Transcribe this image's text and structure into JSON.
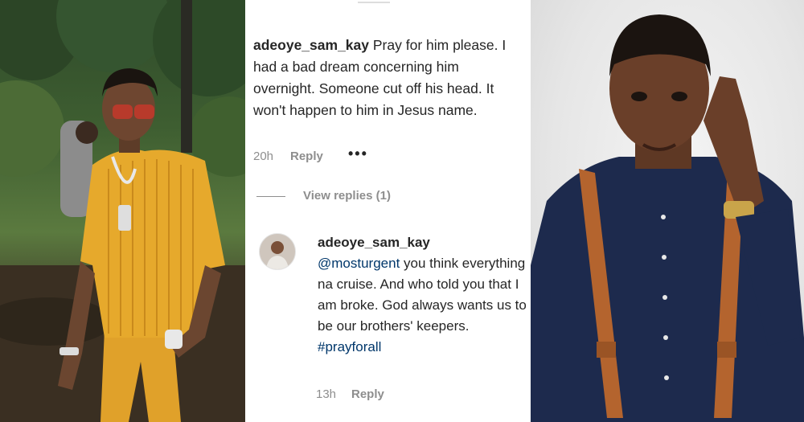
{
  "comment_main": {
    "username": "adeoye_sam_kay",
    "text": "Pray for him please. I had a bad dream concerning him overnight. Someone cut off his head. It won't happen to him in Jesus name.",
    "time": "20h",
    "reply_label": "Reply",
    "more_label": "•••"
  },
  "view_replies": {
    "label": "View replies (1)"
  },
  "reply_comment": {
    "username": "adeoye_sam_kay",
    "mention": "@mosturgent",
    "text": " you think everything na cruise. And who told you that I am broke. God always wants us to be our brothers' keepers.",
    "hashtag": "#prayforall",
    "time": "13h",
    "reply_label": "Reply"
  },
  "colors": {
    "text": "#262626",
    "meta": "#8e8e8e",
    "link": "#00376b",
    "shirt_left": "#e6a92c",
    "shirt_right": "#1d2a4d",
    "suspender": "#b4642e"
  },
  "icons": {
    "avatar": "user-avatar",
    "more": "more-dots-icon"
  }
}
